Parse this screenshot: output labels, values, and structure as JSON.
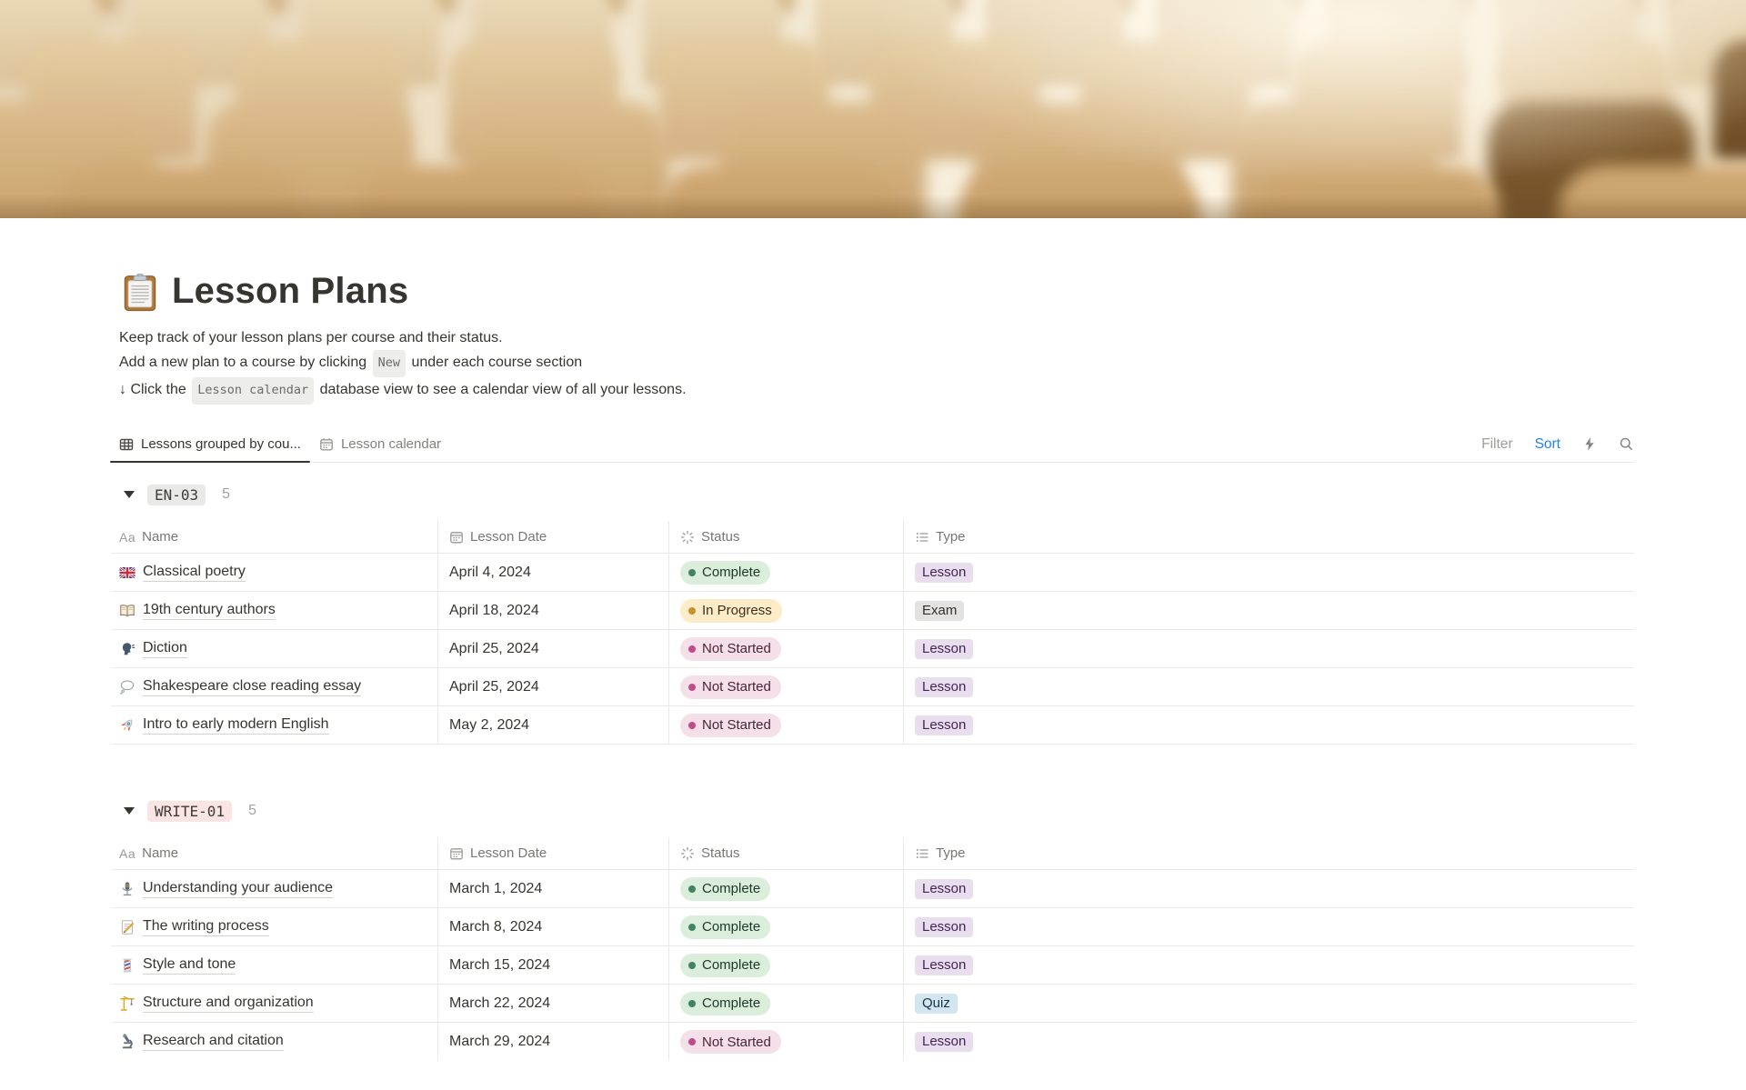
{
  "page": {
    "icon": "clipboard-icon",
    "title": "Lesson Plans"
  },
  "description": {
    "line1": "Keep track of your lesson plans per course and their status.",
    "line2_pre": "Add a new plan to a course by clicking",
    "line2_chip": "New",
    "line2_post": "under each course section",
    "line3_pre": "↓ Click the",
    "line3_chip": "Lesson calendar",
    "line3_post": "database view to see a calendar view of all your lessons."
  },
  "viewbar": {
    "tabs": [
      {
        "label": "Lessons grouped by cou...",
        "icon": "table-view-icon",
        "active": true
      },
      {
        "label": "Lesson calendar",
        "icon": "calendar-view-icon",
        "active": false
      }
    ],
    "filter_label": "Filter",
    "sort_label": "Sort",
    "icons": [
      "lightning-icon",
      "search-icon"
    ]
  },
  "table": {
    "columns": [
      {
        "label": "Name",
        "icon": "aa-text-icon"
      },
      {
        "label": "Lesson Date",
        "icon": "calendar-icon"
      },
      {
        "label": "Status",
        "icon": "status-burst-icon"
      },
      {
        "label": "Type",
        "icon": "bulleted-list-icon"
      }
    ]
  },
  "groups": [
    {
      "name": "EN-03",
      "count": "5",
      "chip_color": "#E9E9E7",
      "rows": [
        {
          "icon": "uk-flag-icon",
          "name": "Classical poetry",
          "date": "April 4, 2024",
          "status": "Complete",
          "type": "Lesson"
        },
        {
          "icon": "open-book-icon",
          "name": "19th century authors",
          "date": "April 18, 2024",
          "status": "In Progress",
          "type": "Exam"
        },
        {
          "icon": "speaking-head-icon",
          "name": "Diction",
          "date": "April 25, 2024",
          "status": "Not Started",
          "type": "Lesson"
        },
        {
          "icon": "thought-balloon-icon",
          "name": "Shakespeare close reading essay",
          "date": "April 25, 2024",
          "status": "Not Started",
          "type": "Lesson"
        },
        {
          "icon": "rocket-icon",
          "name": "Intro to early modern English",
          "date": "May 2, 2024",
          "status": "Not Started",
          "type": "Lesson"
        }
      ]
    },
    {
      "name": "WRITE-01",
      "count": "5",
      "chip_color": "#FBE4E4",
      "rows": [
        {
          "icon": "microphone-icon",
          "name": "Understanding your audience",
          "date": "March 1, 2024",
          "status": "Complete",
          "type": "Lesson"
        },
        {
          "icon": "memo-icon",
          "name": "The writing process",
          "date": "March 8, 2024",
          "status": "Complete",
          "type": "Lesson"
        },
        {
          "icon": "barber-pole-icon",
          "name": "Style and tone",
          "date": "March 15, 2024",
          "status": "Complete",
          "type": "Lesson"
        },
        {
          "icon": "crane-icon",
          "name": "Structure and organization",
          "date": "March 22, 2024",
          "status": "Complete",
          "type": "Quiz"
        },
        {
          "icon": "microscope-icon",
          "name": "Research and citation",
          "date": "March 29, 2024",
          "status": "Not Started",
          "type": "Lesson"
        }
      ]
    }
  ],
  "colors": {
    "sort_accent": "#2383E2",
    "status_complete_bg": "#DBEDDB",
    "status_complete_dot": "#448361",
    "status_in_progress_bg": "#FDECC8",
    "status_in_progress_dot": "#CB912F",
    "status_not_started_bg": "#F5E0E9",
    "status_not_started_dot": "#C14C8A",
    "type_lesson_bg": "#E8DEEE",
    "type_exam_bg": "#E3E2E0",
    "type_quiz_bg": "#D3E5EF"
  }
}
